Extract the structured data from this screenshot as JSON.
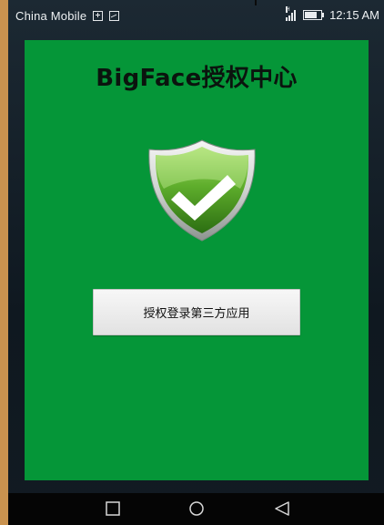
{
  "status_bar": {
    "carrier": "China Mobile",
    "network_label": "H",
    "time": "12:15 AM"
  },
  "app": {
    "title": "BigFace授权中心",
    "auth_button_label": "授权登录第三方应用",
    "background_color": "#059638"
  },
  "icons": {
    "shield": "shield-check-icon",
    "notification_1": "add-box-icon",
    "notification_2": "image-icon",
    "signal": "signal-icon",
    "battery": "battery-icon",
    "nav_recent": "recent-apps-icon",
    "nav_home": "home-icon",
    "nav_back": "back-icon"
  }
}
